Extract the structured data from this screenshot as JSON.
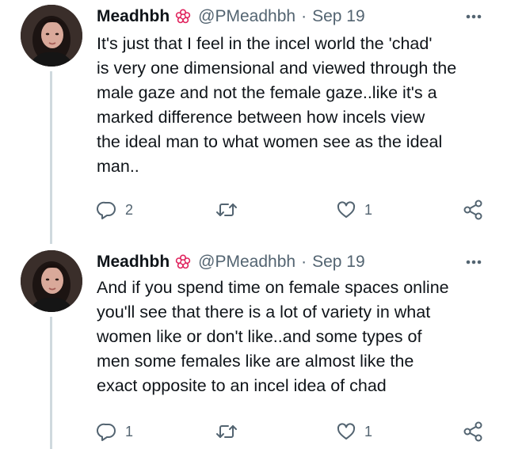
{
  "tweets": [
    {
      "display_name": "Meadhbh",
      "handle": "@PMeadhbh",
      "separator": "·",
      "date": "Sep 19",
      "text": "It's just that I feel in the incel world the 'chad'\nis very one dimensional and viewed through the\nmale gaze and not the female gaze..like it's a\nmarked difference between how incels view\nthe ideal man to what women see as the ideal\nman..",
      "reply_count": "2",
      "retweet_count": "",
      "like_count": "1"
    },
    {
      "display_name": "Meadhbh",
      "handle": "@PMeadhbh",
      "separator": "·",
      "date": "Sep 19",
      "text": "And if you spend time on female spaces online\nyou'll see that there is a lot of variety in what\nwomen like or don't like..and some types of\nmen some females like are almost like the\nexact opposite to an incel idea of chad",
      "reply_count": "1",
      "retweet_count": "",
      "like_count": "1"
    }
  ],
  "icons": {
    "badge": "flower-badge-icon",
    "more": "more-options-icon",
    "reply": "reply-icon",
    "retweet": "retweet-icon",
    "like": "heart-icon",
    "share": "share-icon"
  },
  "colors": {
    "text": "#0f1419",
    "secondary": "#536471",
    "thread_line": "#cfd9de",
    "badge": "#e0245e"
  }
}
